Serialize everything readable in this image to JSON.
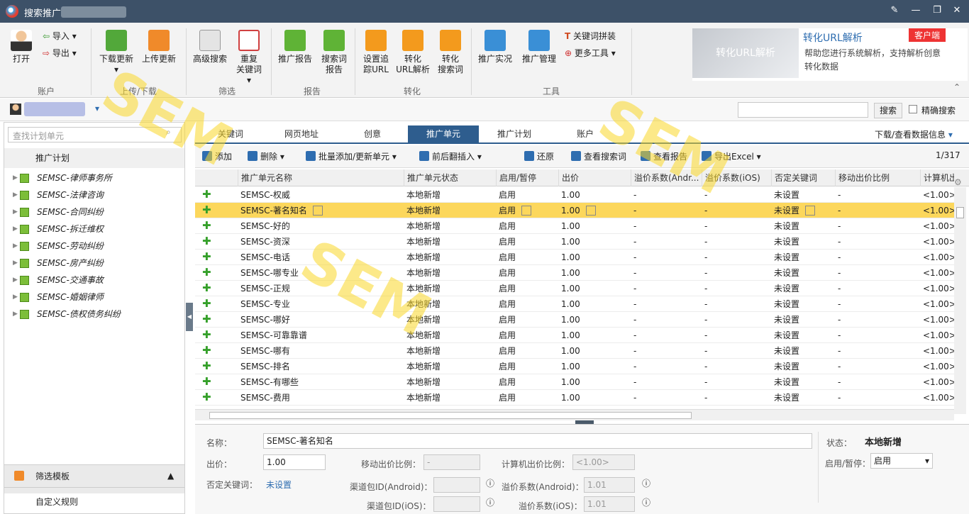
{
  "titlebar": {
    "title": "搜索推广"
  },
  "ribbon": {
    "open": "打开",
    "import": "导入",
    "export": "导出",
    "download_update": "下载更新",
    "upload_update": "上传更新",
    "advanced_search": "高级搜索",
    "repeat_kw_l1": "重复",
    "repeat_kw_l2": "关键词",
    "report_promo": "推广报告",
    "report_search_l1": "搜索词",
    "report_search_l2": "报告",
    "track_l1": "设置追",
    "track_l2": "踪URL",
    "conv_url_l1": "转化",
    "conv_url_l2": "URL解析",
    "conv_search_l1": "转化",
    "conv_search_l2": "搜索词",
    "promo_live": "推广实况",
    "promo_manage": "推广管理",
    "kw_splice": "关键词拼装",
    "more_tools": "更多工具",
    "groups": {
      "account": "账户",
      "updown": "上传/下载",
      "filter": "筛选",
      "report": "报告",
      "convert": "转化",
      "tools": "工具"
    },
    "promo_box": {
      "img_text": "转化URL解析",
      "title": "转化URL解析",
      "badge": "客户端",
      "desc": "帮助您进行系统解析，支持解析创意转化数据"
    }
  },
  "userbar": {
    "search_btn": "搜索",
    "exact": "精确搜索"
  },
  "left": {
    "search_placeholder": "查找计划单元",
    "header": "推广计划",
    "items": [
      "SEMSC-律师事务所",
      "SEMSC-法律咨询",
      "SEMSC-合同纠纷",
      "SEMSC-拆迁维权",
      "SEMSC-劳动纠纷",
      "SEMSC-房产纠纷",
      "SEMSC-交通事故",
      "SEMSC-婚姻律师",
      "SEMSC-债权债务纠纷"
    ],
    "filter_template": "筛选模板",
    "custom_rule": "自定义规则"
  },
  "tabs": [
    "关键词",
    "网页地址",
    "创意",
    "推广单元",
    "推广计划",
    "账户"
  ],
  "download_info": "下载/查看数据信息",
  "toolbar": {
    "add": "添加",
    "delete": "删除",
    "batch": "批量添加/更新单元",
    "insert": "前后翻插入",
    "restore": "还原",
    "view_search": "查看搜索词",
    "view_report": "查看报告",
    "export_excel": "导出Excel",
    "page": "1/317"
  },
  "columns": [
    "推广单元名称",
    "推广单元状态",
    "启用/暂停",
    "出价",
    "溢价系数(Andr...",
    "溢价系数(iOS)",
    "否定关键词",
    "移动出价比例",
    "计算机出"
  ],
  "rows": [
    [
      "SEMSC-权威",
      "本地新增",
      "启用",
      "1.00",
      "-",
      "-",
      "未设置",
      "-",
      "<1.00>"
    ],
    [
      "SEMSC-著名知名",
      "本地新增",
      "启用",
      "1.00",
      "-",
      "-",
      "未设置",
      "-",
      "<1.00>"
    ],
    [
      "SEMSC-好的",
      "本地新增",
      "启用",
      "1.00",
      "-",
      "-",
      "未设置",
      "-",
      "<1.00>"
    ],
    [
      "SEMSC-资深",
      "本地新增",
      "启用",
      "1.00",
      "-",
      "-",
      "未设置",
      "-",
      "<1.00>"
    ],
    [
      "SEMSC-电话",
      "本地新增",
      "启用",
      "1.00",
      "-",
      "-",
      "未设置",
      "-",
      "<1.00>"
    ],
    [
      "SEMSC-哪专业",
      "本地新增",
      "启用",
      "1.00",
      "-",
      "-",
      "未设置",
      "-",
      "<1.00>"
    ],
    [
      "SEMSC-正规",
      "本地新增",
      "启用",
      "1.00",
      "-",
      "-",
      "未设置",
      "-",
      "<1.00>"
    ],
    [
      "SEMSC-专业",
      "本地新增",
      "启用",
      "1.00",
      "-",
      "-",
      "未设置",
      "-",
      "<1.00>"
    ],
    [
      "SEMSC-哪好",
      "本地新增",
      "启用",
      "1.00",
      "-",
      "-",
      "未设置",
      "-",
      "<1.00>"
    ],
    [
      "SEMSC-可靠靠谱",
      "本地新增",
      "启用",
      "1.00",
      "-",
      "-",
      "未设置",
      "-",
      "<1.00>"
    ],
    [
      "SEMSC-哪有",
      "本地新增",
      "启用",
      "1.00",
      "-",
      "-",
      "未设置",
      "-",
      "<1.00>"
    ],
    [
      "SEMSC-排名",
      "本地新增",
      "启用",
      "1.00",
      "-",
      "-",
      "未设置",
      "-",
      "<1.00>"
    ],
    [
      "SEMSC-有哪些",
      "本地新增",
      "启用",
      "1.00",
      "-",
      "-",
      "未设置",
      "-",
      "<1.00>"
    ],
    [
      "SEMSC-费用",
      "本地新增",
      "启用",
      "1.00",
      "-",
      "-",
      "未设置",
      "-",
      "<1.00>"
    ]
  ],
  "selected_row": 1,
  "detail": {
    "name_label": "名称：",
    "name_value": "SEMSC-著名知名",
    "bid_label": "出价：",
    "bid_value": "1.00",
    "mobile_ratio_label": "移动出价比例：",
    "mobile_ratio_value": "-",
    "pc_ratio_label": "计算机出价比例：",
    "pc_ratio_value": "<1.00>",
    "neg_kw_label": "否定关键词：",
    "neg_kw_value": "未设置",
    "android_pkg_label": "渠道包ID(Android)：",
    "ios_pkg_label": "渠道包ID(iOS)：",
    "android_prem_label": "溢价系数(Android)：",
    "android_prem_value": "1.01",
    "ios_prem_label": "溢价系数(iOS)：",
    "ios_prem_value": "1.01",
    "status_label": "状态：",
    "status_value": "本地新增",
    "toggle_label": "启用/暂停：",
    "toggle_value": "启用"
  }
}
